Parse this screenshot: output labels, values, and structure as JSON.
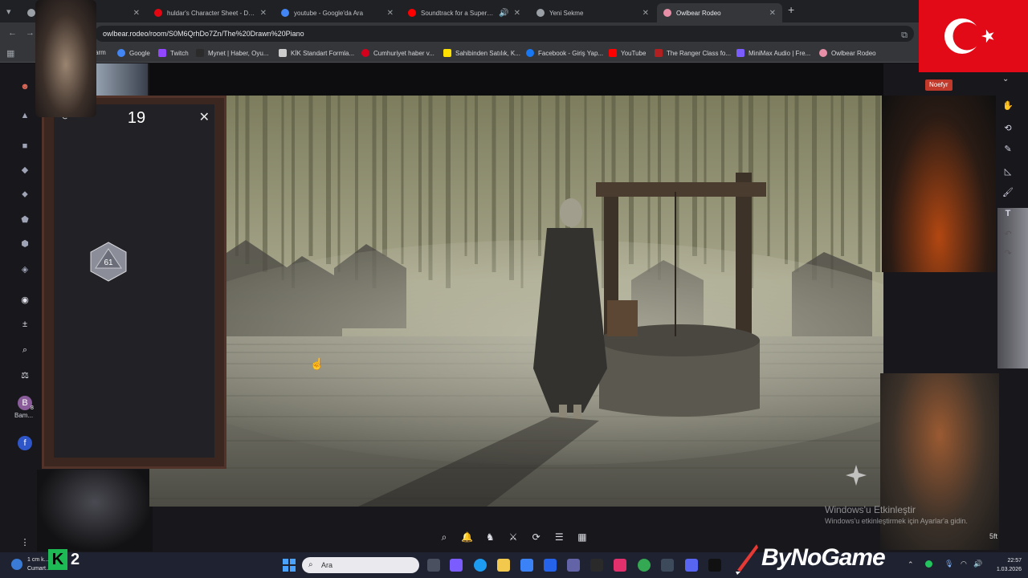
{
  "browser": {
    "tabs": [
      {
        "title": "Yeni Sekme",
        "favicon_color": "#9aa0a6"
      },
      {
        "title": "huldar's Character Sheet - D&D",
        "favicon_color": "#e40712"
      },
      {
        "title": "youtube - Google'da Ara",
        "favicon_color": "#4285f4"
      },
      {
        "title": "Soundtrack for a Supervillain",
        "favicon_color": "#ff0000"
      },
      {
        "title": "Yeni Sekme",
        "favicon_color": "#9aa0a6"
      },
      {
        "title": "Owlbear Rodeo",
        "favicon_color": "#e88fa8"
      }
    ],
    "url": "owlbear.rodeo/room/S0M6QrhDo7Zn/The%20Drawn%20Piano",
    "bookmarks": [
      {
        "label": "arm",
        "color": "#888888"
      },
      {
        "label": "Google",
        "color": "#4285f4"
      },
      {
        "label": "Twitch",
        "color": "#9146ff"
      },
      {
        "label": "Mynet | Haber, Oyu...",
        "color": "#2b2b2b"
      },
      {
        "label": "KİK Standart Formla...",
        "color": "#cccccc"
      },
      {
        "label": "Cumhuriyet haber v...",
        "color": "#d6001c"
      },
      {
        "label": "Sahibinden Satılık, K...",
        "color": "#ffe000"
      },
      {
        "label": "Facebook - Giriş Yap...",
        "color": "#1877f2"
      },
      {
        "label": "YouTube",
        "color": "#ff0000"
      },
      {
        "label": "The Ranger Class fo...",
        "color": "#b02020"
      },
      {
        "label": "MiniMax Audio | Fre...",
        "color": "#7b5cff"
      },
      {
        "label": "Owlbear Rodeo",
        "color": "#e88fa8"
      }
    ]
  },
  "dice_tray": {
    "result": "19",
    "die_face": "61"
  },
  "sidebar": {
    "player_label": "Bam...",
    "player_initial": "B",
    "player_badge": "8"
  },
  "player_chip": {
    "name": "Noefyr"
  },
  "map": {
    "scale": "5ft"
  },
  "watermark": {
    "title": "Windows'u Etkinleştir",
    "subtitle": "Windows'u etkinleştirmek için Ayarlar'a gidin."
  },
  "taskbar": {
    "search_placeholder": "Ara",
    "weather_line1": "1 cm k...",
    "weather_line2": "Cumart...",
    "time": "22:57",
    "date": "1.03.2026"
  },
  "overlay": {
    "brand": "ByNoGame",
    "channel_badge": "2"
  },
  "colors": {
    "flag_red": "#e30a17",
    "workspace": "#17171c",
    "accent": "#7b6cf6"
  }
}
